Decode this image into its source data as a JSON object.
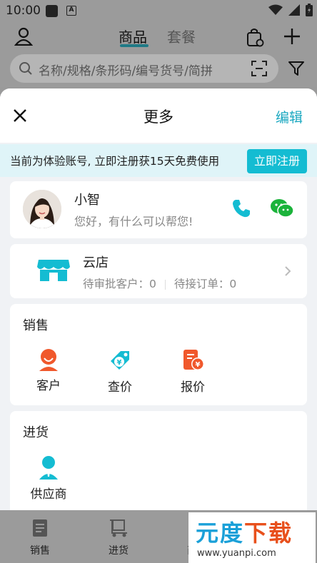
{
  "status": {
    "time": "10:00"
  },
  "topbar": {
    "tabs": [
      "商品",
      "套餐"
    ],
    "search_placeholder": "名称/规格/条形码/编号货号/简拼"
  },
  "sheet": {
    "title": "更多",
    "edit_label": "编辑",
    "banner_text": "当前为体验账号, 立即注册获15天免费使用",
    "register_label": "立即注册",
    "assistant": {
      "name": "小智",
      "message": "您好，有什么可以帮您!"
    },
    "store": {
      "name": "云店",
      "pending_customers_label": "待审批客户：",
      "pending_customers": "0",
      "pending_orders_label": "待接订单：",
      "pending_orders": "0"
    },
    "sales": {
      "title": "销售",
      "items": [
        "客户",
        "查价",
        "报价"
      ]
    },
    "purchase": {
      "title": "进货",
      "items": [
        "供应商"
      ]
    }
  },
  "bottom_nav": [
    "销售",
    "进货",
    "商品"
  ],
  "watermark": {
    "brand_part1": "元度",
    "brand_part2": "下载",
    "url": "www.yuanpi.com"
  },
  "colors": {
    "accent": "#14bcd2",
    "orange": "#f0582c",
    "teal_icon": "#1aa8c0"
  }
}
